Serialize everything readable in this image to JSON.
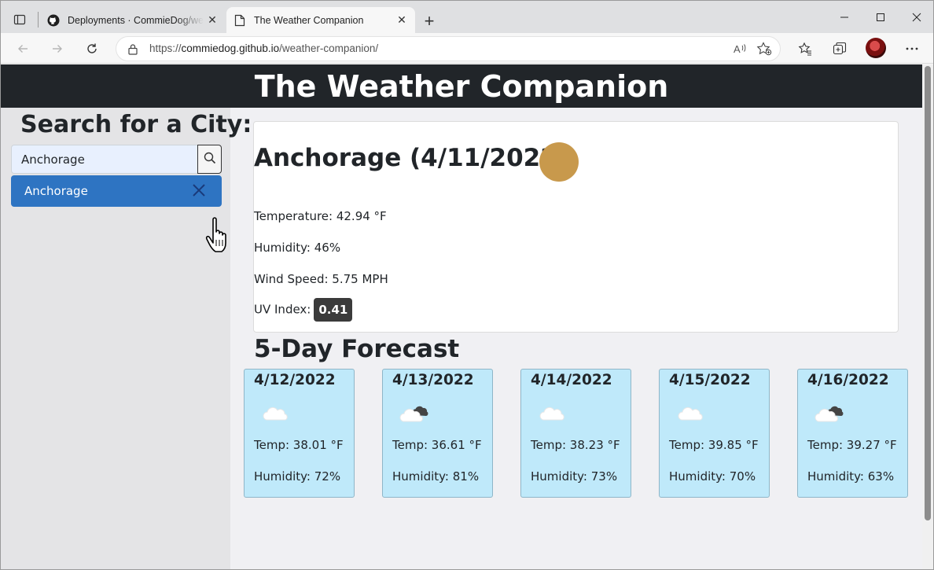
{
  "browser": {
    "tabs": [
      {
        "title": "Deployments · CommieDog/weather-companion",
        "active": false,
        "icon": "github-icon"
      },
      {
        "title": "The Weather Companion",
        "active": true,
        "icon": "page-icon"
      }
    ],
    "url_prefix": "https://",
    "url_host": "commiedog.github.io",
    "url_path": "/weather-companion/"
  },
  "site": {
    "header": "The Weather Companion"
  },
  "sidebar": {
    "heading": "Search for a City:",
    "search_value": "Anchorage",
    "history": [
      {
        "label": "Anchorage"
      }
    ]
  },
  "current": {
    "title": "Anchorage (4/11/2022)",
    "icon": "clear-sky-icon",
    "temperature": "Temperature: 42.94 °F",
    "humidity": "Humidity: 46%",
    "wind": "Wind Speed: 5.75 MPH",
    "uv_label": "UV Index:",
    "uv_value": "0.41",
    "sun_color": "#c8994c"
  },
  "forecast": {
    "title": "5-Day Forecast",
    "days": [
      {
        "date": "4/12/2022",
        "icon": "cloud-icon",
        "temp": "Temp: 38.01 °F",
        "humidity": "Humidity: 72%"
      },
      {
        "date": "4/13/2022",
        "icon": "broken-clouds-icon",
        "temp": "Temp: 36.61 °F",
        "humidity": "Humidity: 81%"
      },
      {
        "date": "4/14/2022",
        "icon": "cloud-icon",
        "temp": "Temp: 38.23 °F",
        "humidity": "Humidity: 73%"
      },
      {
        "date": "4/15/2022",
        "icon": "cloud-icon",
        "temp": "Temp: 39.85 °F",
        "humidity": "Humidity: 70%"
      },
      {
        "date": "4/16/2022",
        "icon": "broken-clouds-icon",
        "temp": "Temp: 39.27 °F",
        "humidity": "Humidity: 63%"
      }
    ]
  },
  "colors": {
    "header_bg": "#212529",
    "history_bg": "#2e74c2",
    "forecast_card_bg": "#bfe9fa",
    "uv_badge_bg": "#3b3b3b"
  }
}
